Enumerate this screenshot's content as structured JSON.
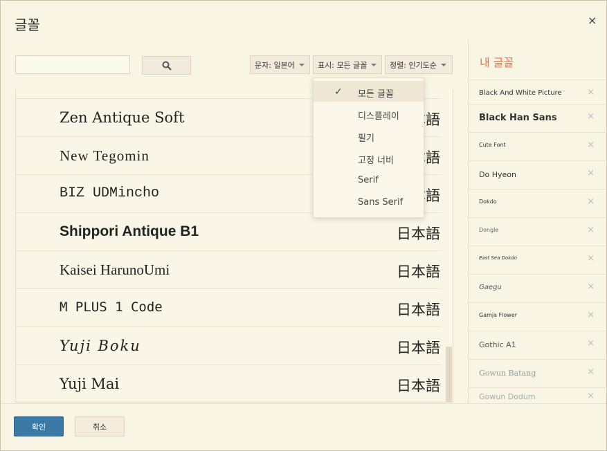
{
  "dialog": {
    "title": "글꼴",
    "close_icon": "×"
  },
  "search": {
    "placeholder": "",
    "button_icon": "search-icon"
  },
  "filters": {
    "script": "문자: 일본어",
    "show": "표시: 모든 글꼴",
    "sort": "정렬: 인기도순"
  },
  "dropdown": {
    "items": [
      {
        "label": "모든 글꼴",
        "selected": true
      },
      {
        "label": "디스플레이",
        "selected": false
      },
      {
        "label": "필기",
        "selected": false
      },
      {
        "label": "고정 너비",
        "selected": false
      },
      {
        "label": "Serif",
        "selected": false
      },
      {
        "label": "Sans Serif",
        "selected": false
      }
    ]
  },
  "font_list": {
    "rows": [
      {
        "name": "Zen Antique Soft",
        "sample": "日本語"
      },
      {
        "name": "New Tegomin",
        "sample": "日本語"
      },
      {
        "name": "BIZ UDMincho",
        "sample": "日本語"
      },
      {
        "name": "Shippori Antique B1",
        "sample": "日本語"
      },
      {
        "name": "Kaisei HarunoUmi",
        "sample": "日本語"
      },
      {
        "name": "M PLUS 1 Code",
        "sample": "日本語"
      },
      {
        "name": "Yuji Boku",
        "sample": "日本語"
      },
      {
        "name": "Yuji Mai",
        "sample": "日本語"
      }
    ]
  },
  "my_fonts": {
    "title": "내 글꼴",
    "items": [
      "Black And White Picture",
      "Black Han Sans",
      "Cute Font",
      "Do Hyeon",
      "Dokdo",
      "Dongle",
      "East Sea Dokdo",
      "Gaegu",
      "Gamja Flower",
      "Gothic A1",
      "Gowun Batang",
      "Gowun Dodum"
    ],
    "remove_icon": "×"
  },
  "buttons": {
    "ok": "확인",
    "cancel": "취소"
  },
  "colors": {
    "accent": "#e8754e",
    "primary_button": "#3c78a4"
  }
}
